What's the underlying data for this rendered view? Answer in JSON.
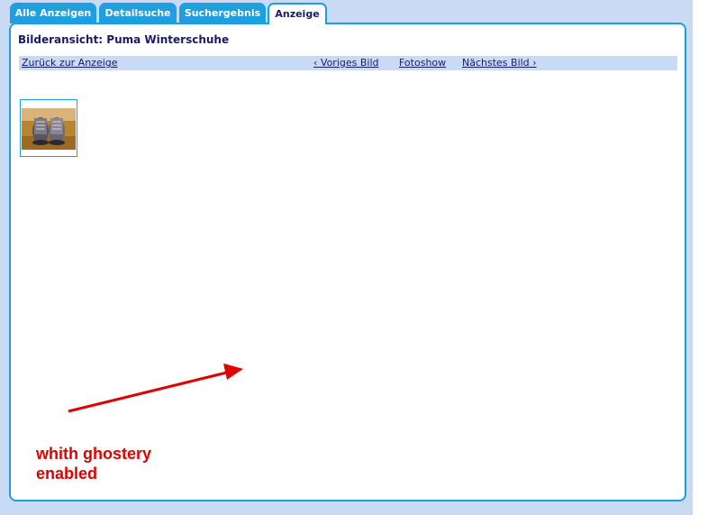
{
  "tabs": [
    {
      "label": "Alle Anzeigen"
    },
    {
      "label": "Detailsuche"
    },
    {
      "label": "Suchergebnis"
    },
    {
      "label": "Anzeige"
    }
  ],
  "page": {
    "title": "Bilderansicht: Puma Winterschuhe"
  },
  "nav": {
    "back_label": "Zurück zur Anzeige",
    "prev_label": "‹ Voriges Bild",
    "slideshow_label": "Fotoshow",
    "next_label": "Nächstes Bild ›"
  },
  "annotation": {
    "line1": "whith ghostery",
    "line2": "enabled"
  },
  "colors": {
    "tab_blue": "#1e9fe0",
    "page_bg": "#c9daf5",
    "link": "#1a1a6a",
    "annotation_red": "#e00000"
  }
}
